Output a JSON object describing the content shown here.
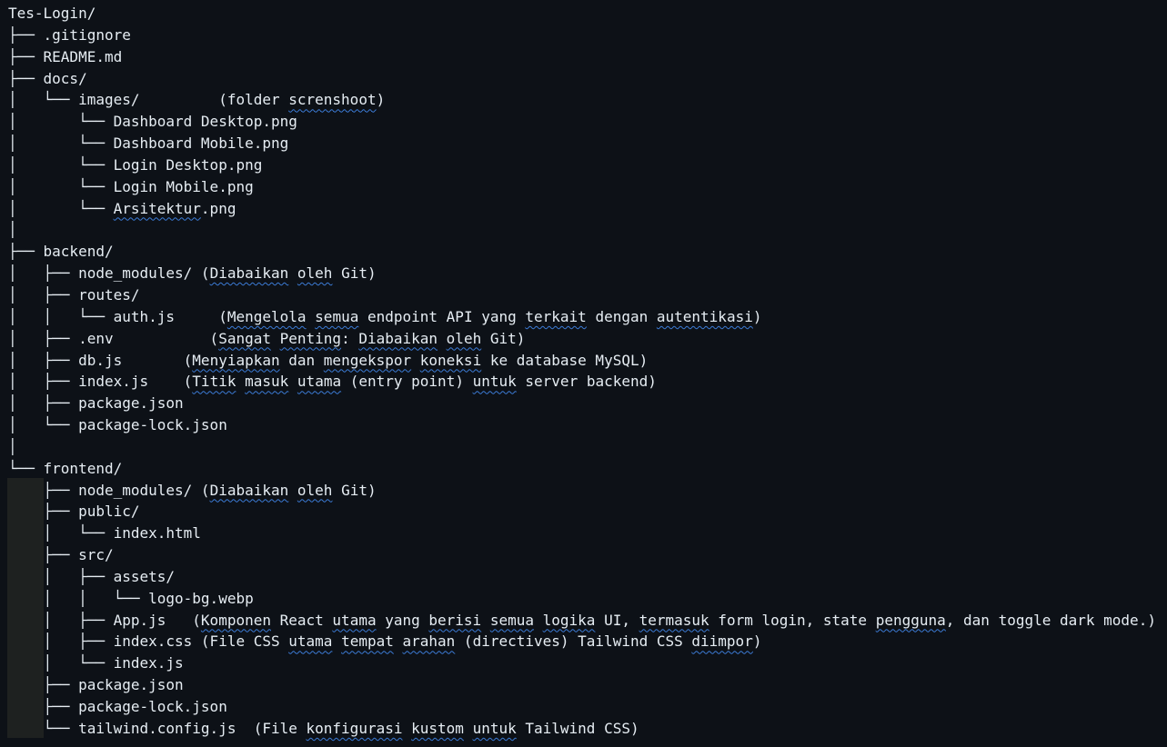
{
  "editor": {
    "lines": [
      [
        "Tes-Login/"
      ],
      [
        "├── .gitignore"
      ],
      [
        "├── README.md"
      ],
      [
        "├── docs/"
      ],
      [
        "│   └── images/         (folder ",
        {
          "s": "screnshoot"
        },
        ")"
      ],
      [
        "│       └── Dashboard Desktop.png"
      ],
      [
        "│       └── Dashboard Mobile.png"
      ],
      [
        "│       └── Login Desktop.png"
      ],
      [
        "│       └── Login Mobile.png"
      ],
      [
        "│       └── ",
        {
          "s": "Arsitektur"
        },
        ".png"
      ],
      [
        "│"
      ],
      [
        "├── backend/"
      ],
      [
        "│   ├── node_modules/ (",
        {
          "s": "Diabaikan"
        },
        " ",
        {
          "s": "oleh"
        },
        " Git)"
      ],
      [
        "│   ├── routes/"
      ],
      [
        "│   │   └── auth.js     (",
        {
          "s": "Mengelola"
        },
        " ",
        {
          "s": "semua"
        },
        " endpoint API yang ",
        {
          "s": "terkait"
        },
        " dengan ",
        {
          "s": "autentikasi"
        },
        ")"
      ],
      [
        "│   ├── .env           (",
        {
          "s": "Sangat"
        },
        " ",
        {
          "s": "Penting"
        },
        ": ",
        {
          "s": "Diabaikan"
        },
        " ",
        {
          "s": "oleh"
        },
        " Git)"
      ],
      [
        "│   ├── db.js       (",
        {
          "s": "Menyiapkan"
        },
        " dan ",
        {
          "s": "mengekspor"
        },
        " ",
        {
          "s": "koneksi"
        },
        " ke database MySQL)"
      ],
      [
        "│   ├── index.js    (",
        {
          "s": "Titik"
        },
        " ",
        {
          "s": "masuk"
        },
        " ",
        {
          "s": "utama"
        },
        " (entry point) ",
        {
          "s": "untuk"
        },
        " server backend)"
      ],
      [
        "│   ├── package.json"
      ],
      [
        "│   └── package-lock.json"
      ],
      [
        "│"
      ],
      [
        "└── frontend/"
      ],
      [
        "    ├── node_modules/ (",
        {
          "s": "Diabaikan"
        },
        " ",
        {
          "s": "oleh"
        },
        " Git)"
      ],
      [
        "    ├── public/"
      ],
      [
        "    │   └── index.html"
      ],
      [
        "    ├── src/"
      ],
      [
        "    │   ├── assets/"
      ],
      [
        "    │   │   └── logo-bg.webp"
      ],
      [
        "    │   ├── App.js   (",
        {
          "s": "Komponen"
        },
        " React ",
        {
          "s": "utama"
        },
        " yang ",
        {
          "s": "berisi"
        },
        " ",
        {
          "s": "semua"
        },
        " ",
        {
          "s": "logika"
        },
        " UI, ",
        {
          "s": "termasuk"
        },
        " form login, state ",
        {
          "s": "pengguna"
        },
        ", dan toggle dark mode.)"
      ],
      [
        "    │   ├── index.css (File CSS ",
        {
          "s": "utama"
        },
        " ",
        {
          "s": "tempat"
        },
        " ",
        {
          "s": "arahan"
        },
        " (directives) Tailwind CSS ",
        {
          "s": "diimpor"
        },
        ")"
      ],
      [
        "    │   └── index.js"
      ],
      [
        "    ├── package.json"
      ],
      [
        "    ├── package-lock.json"
      ],
      [
        "    └── tailwind.config.js  (File ",
        {
          "s": "konfigurasi"
        },
        " ",
        {
          "s": "kustom"
        },
        " ",
        {
          "s": "untuk"
        },
        " Tailwind CSS)"
      ]
    ]
  }
}
